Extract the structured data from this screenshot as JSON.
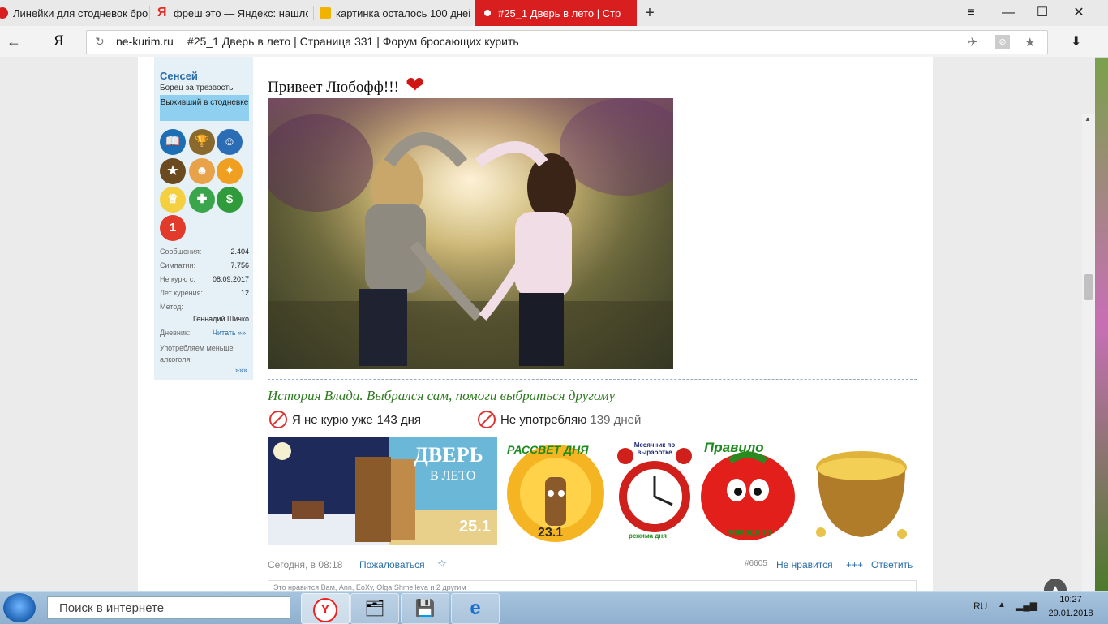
{
  "browser": {
    "tabs": [
      {
        "label": "Линейки для стодневок бро"
      },
      {
        "label": "фреш это — Яндекс: нашло"
      },
      {
        "label": "картинка осталось 100 дней"
      },
      {
        "label": "#25_1 Дверь в лето | Стр"
      }
    ],
    "new_tab": "+",
    "window_controls": {
      "menu": "≡",
      "minimize": "—",
      "maximize": "☐",
      "close": "✕"
    },
    "back": "←",
    "logo": "Я",
    "url_domain": "ne-kurim.ru",
    "url_title": "#25_1 Дверь в лето | Страница 331 | Форум бросающих курить",
    "download": "⬇"
  },
  "user": {
    "name": "Сенсей",
    "title": "Борец за трезвость",
    "banner": "Выживший в стодневке",
    "award_badge_number": "1",
    "stats": [
      {
        "label": "Сообщения:",
        "value": "2.404"
      },
      {
        "label": "Симпатии:",
        "value": "7.756"
      },
      {
        "label": "Не курю с:",
        "value": "08.09.2017"
      },
      {
        "label": "Лет курения:",
        "value": "12"
      }
    ],
    "method_label": "Метод:",
    "method_value": "Геннадий Шичко",
    "diary_label": "Дневник:",
    "diary_link": "Читать »»",
    "alcohol_label": "Употребляем меньше алкоголя:",
    "more_link": "»»»"
  },
  "post": {
    "greeting": "Привеет Любофф!!!",
    "heart": "❤",
    "signature_title": "История Влада. Выбрался сам, помоги выбраться другому",
    "counter1_prefix": "Я не курю уже",
    "counter1_value": "143 дня",
    "counter2_prefix": "Не употребляю",
    "counter2_value": "139 дней",
    "banner_texts": {
      "door_title": "ДВЕРЬ",
      "door_sub": "В ЛЕТО",
      "door_num": "25.1",
      "dawn_title": "РАССВЕТ ДНЯ",
      "dawn_num": "23.1",
      "clock_top": "Месячник по выработке",
      "clock_bottom": "режима дня",
      "tomato_title": "Правило",
      "tomato_sub": "помодоро"
    },
    "date": "Сегодня, в 08:18",
    "complain": "Пожаловаться",
    "star": "☆",
    "post_number": "#6605",
    "dislike": "Не нравится",
    "plus": "+++",
    "reply": "Ответить",
    "likes_text": "Это нравится Вам, Ann, ЕоХу, Olga Shmeileva и 2 другим"
  },
  "scroll": {
    "up": "▲",
    "down": "▼"
  },
  "taskbar": {
    "search_placeholder": "Поиск в интернете",
    "lang": "RU",
    "tray_up": "▲",
    "signal": "▂▄▆",
    "time": "10:27",
    "date": "29.01.2018"
  }
}
